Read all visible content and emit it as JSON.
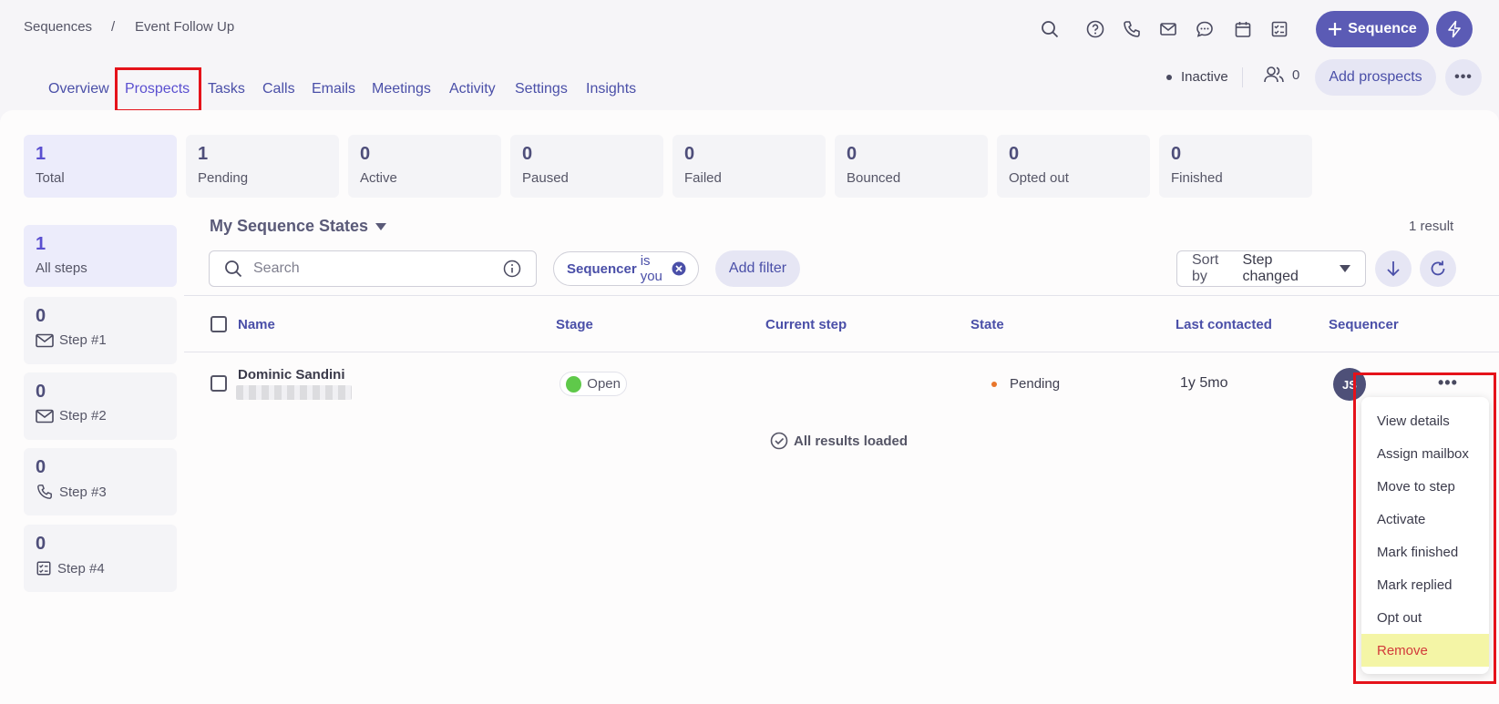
{
  "breadcrumb": {
    "root": "Sequences",
    "separator": "/",
    "current": "Event Follow Up"
  },
  "header_icons": [
    "search-icon",
    "help-icon",
    "phone-icon",
    "mail-icon",
    "chat-icon",
    "calendar-icon",
    "checklist-icon"
  ],
  "primary_button": {
    "label": "Sequence",
    "icon": "plus-icon"
  },
  "bolt_button": {
    "icon": "bolt-icon"
  },
  "tabs": [
    {
      "label": "Overview"
    },
    {
      "label": "Prospects",
      "active": true
    },
    {
      "label": "Tasks"
    },
    {
      "label": "Calls"
    },
    {
      "label": "Emails"
    },
    {
      "label": "Meetings"
    },
    {
      "label": "Activity"
    },
    {
      "label": "Settings"
    },
    {
      "label": "Insights"
    }
  ],
  "status": {
    "label": "Inactive"
  },
  "owners": {
    "count": "0"
  },
  "add_prospects": {
    "label": "Add prospects"
  },
  "summary_cards": [
    {
      "value": "1",
      "label": "Total",
      "active": true
    },
    {
      "value": "1",
      "label": "Pending"
    },
    {
      "value": "0",
      "label": "Active"
    },
    {
      "value": "0",
      "label": "Paused"
    },
    {
      "value": "0",
      "label": "Failed"
    },
    {
      "value": "0",
      "label": "Bounced"
    },
    {
      "value": "0",
      "label": "Opted out"
    },
    {
      "value": "0",
      "label": "Finished"
    }
  ],
  "steps": [
    {
      "value": "1",
      "label": "All steps",
      "icon": "",
      "active": true
    },
    {
      "value": "0",
      "label": "Step #1",
      "icon": "mail-icon"
    },
    {
      "value": "0",
      "label": "Step #2",
      "icon": "mail-icon"
    },
    {
      "value": "0",
      "label": "Step #3",
      "icon": "phone-icon"
    },
    {
      "value": "0",
      "label": "Step #4",
      "icon": "checklist-icon"
    }
  ],
  "view": {
    "title": "My Sequence States",
    "result_count": "1 result"
  },
  "search": {
    "placeholder": "Search",
    "value": ""
  },
  "filter_chip": {
    "key": "Sequencer",
    "value": "is you"
  },
  "add_filter": {
    "label": "Add filter"
  },
  "sort": {
    "prefix": "Sort by",
    "value": "Step changed"
  },
  "table": {
    "columns": [
      "Name",
      "Stage",
      "Current step",
      "State",
      "Last contacted",
      "Sequencer"
    ],
    "rows": [
      {
        "name": "Dominic Sandini",
        "stage": "Open",
        "current_step": "",
        "state": "Pending",
        "last_contacted": "1y 5mo",
        "sequencer_initials": "JS"
      }
    ]
  },
  "footer_text": "All results loaded",
  "row_menu": {
    "items": [
      "View details",
      "Assign mailbox",
      "Move to step",
      "Activate",
      "Mark finished",
      "Mark replied",
      "Opt out",
      "Remove"
    ],
    "highlighted": "Remove"
  },
  "colors": {
    "accent": "#5b5bb5",
    "highlight_box": "#e5121a",
    "danger": "#d23a3a",
    "hover_yellow": "#f4f5a6",
    "open_green": "#5fc94a",
    "pending_orange": "#e8762b"
  }
}
